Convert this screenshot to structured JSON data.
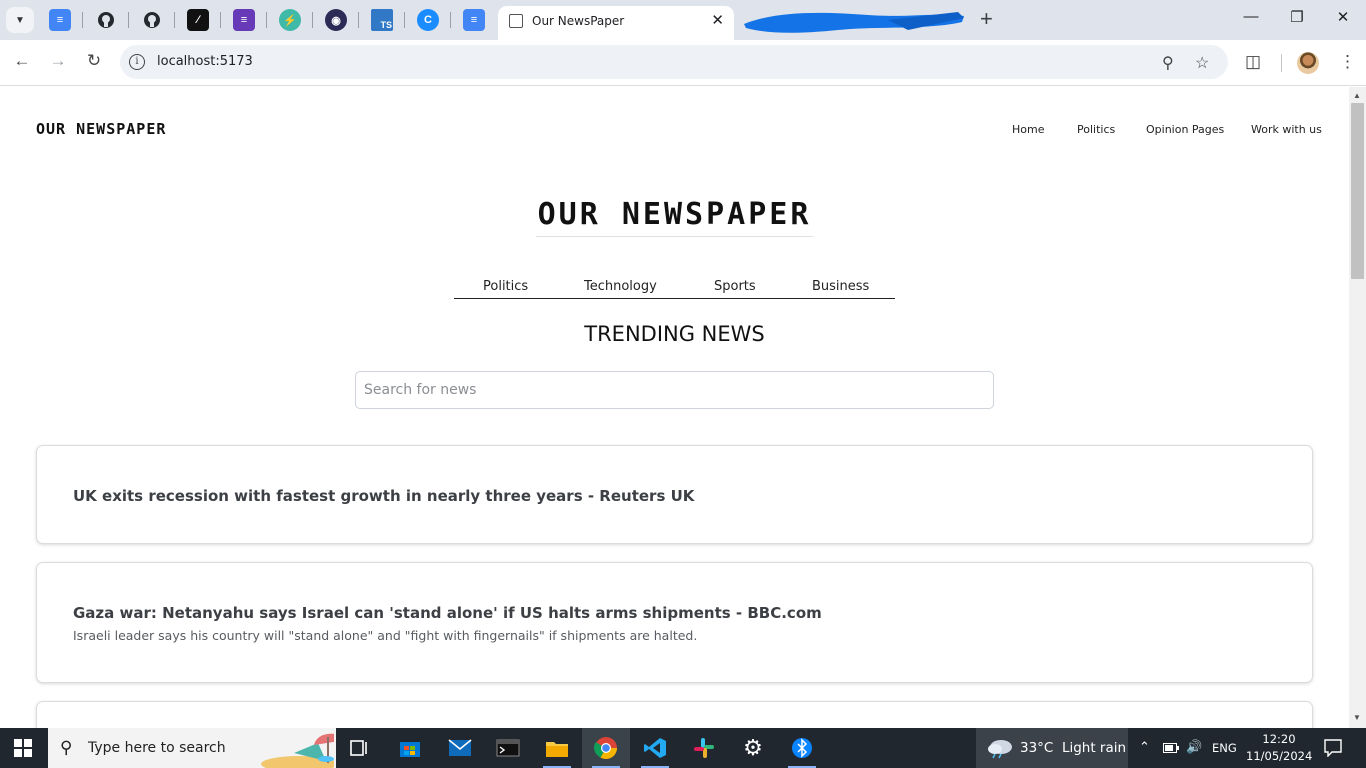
{
  "browser": {
    "active_tab_title": "Our NewsPaper",
    "url": "localhost:5173",
    "pinned_tabs": [
      "google-docs-icon",
      "github-icon",
      "github-icon",
      "notion-icon",
      "forms-icon",
      "bolt-icon",
      "obs-icon",
      "typescript-icon",
      "copilot-icon",
      "google-docs-icon"
    ]
  },
  "page": {
    "brand": "OUR NEWSPAPER",
    "nav": [
      "Home",
      "Politics",
      "Opinion Pages",
      "Work with us"
    ],
    "masthead": "OUR NEWSPAPER",
    "categories": [
      "Politics",
      "Technology",
      "Sports",
      "Business"
    ],
    "section_title": "TRENDING NEWS",
    "search": {
      "placeholder": "Search for news",
      "value": ""
    },
    "articles": [
      {
        "headline": "UK exits recession with fastest growth in nearly three years - Reuters UK",
        "description": ""
      },
      {
        "headline": "Gaza war: Netanyahu says Israel can 'stand alone' if US halts arms shipments - BBC.com",
        "description": "Israeli leader says his country will \"stand alone\" and \"fight with fingernails\" if shipments are halted."
      }
    ]
  },
  "taskbar": {
    "search_placeholder": "Type here to search",
    "weather": {
      "temp": "33°C",
      "condition": "Light rain"
    },
    "language": "ENG",
    "time": "12:20",
    "date": "11/05/2024"
  },
  "colors": {
    "tabstrip": "#dfe3eb",
    "taskbar": "#20272e",
    "card_border": "#dcdcdc",
    "headline": "#3c3f44"
  }
}
